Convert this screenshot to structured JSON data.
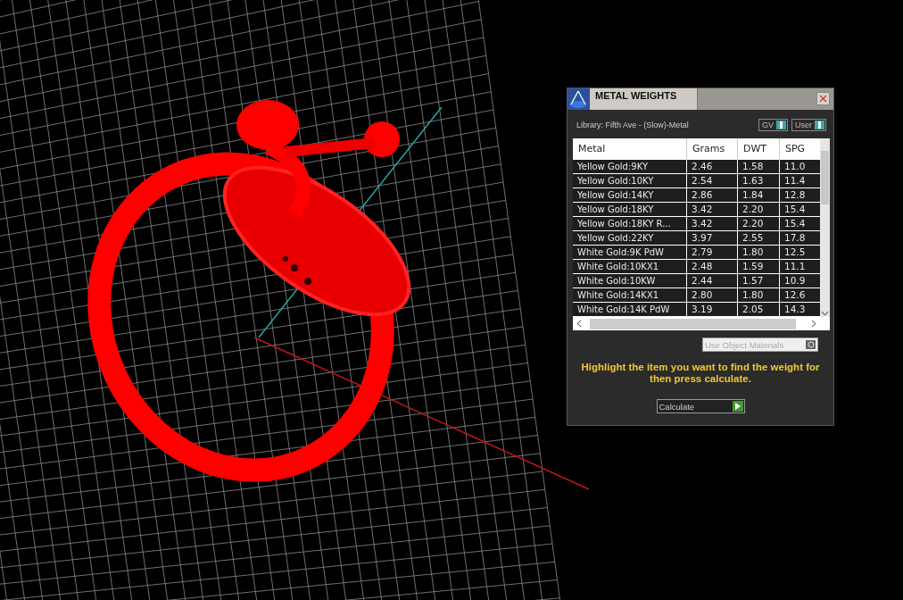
{
  "window": {
    "title": "METAL WEIGHTS"
  },
  "library": "Library: Fifth Ave - (Slow)-Metal",
  "toggles": [
    {
      "label": "GV",
      "on": true
    },
    {
      "label": "User",
      "on": true
    }
  ],
  "table": {
    "columns": [
      "Metal",
      "Grams",
      "DWT",
      "SPG"
    ],
    "rows": [
      {
        "cells": [
          "Yellow Gold:9KY",
          "2.46",
          "1.58",
          "11.0"
        ]
      },
      {
        "cells": [
          "Yellow Gold:10KY",
          "2.54",
          "1.63",
          "11.4"
        ]
      },
      {
        "cells": [
          "Yellow Gold:14KY",
          "2.86",
          "1.84",
          "12.8"
        ]
      },
      {
        "cells": [
          "Yellow Gold:18KY",
          "3.42",
          "2.20",
          "15.4"
        ]
      },
      {
        "cells": [
          "Yellow Gold:18KY R...",
          "3.42",
          "2.20",
          "15.4"
        ]
      },
      {
        "cells": [
          "Yellow Gold:22KY",
          "3.97",
          "2.55",
          "17.8"
        ]
      },
      {
        "cells": [
          "White Gold:9K PdW",
          "2.79",
          "1.80",
          "12.5"
        ]
      },
      {
        "cells": [
          "White Gold:10KX1",
          "2.48",
          "1.59",
          "11.1"
        ]
      },
      {
        "cells": [
          "White Gold:10KW",
          "2.44",
          "1.57",
          "10.9"
        ]
      },
      {
        "cells": [
          "White Gold:14KX1",
          "2.80",
          "1.80",
          "12.6"
        ]
      },
      {
        "cells": [
          "White Gold:14K PdW",
          "3.19",
          "2.05",
          "14.3"
        ]
      }
    ]
  },
  "object_materials": {
    "label": "Use Object Materials",
    "on": false
  },
  "hint": "Highlight the item you want to find the weight for then press calculate.",
  "calculate_button": "Calculate"
}
